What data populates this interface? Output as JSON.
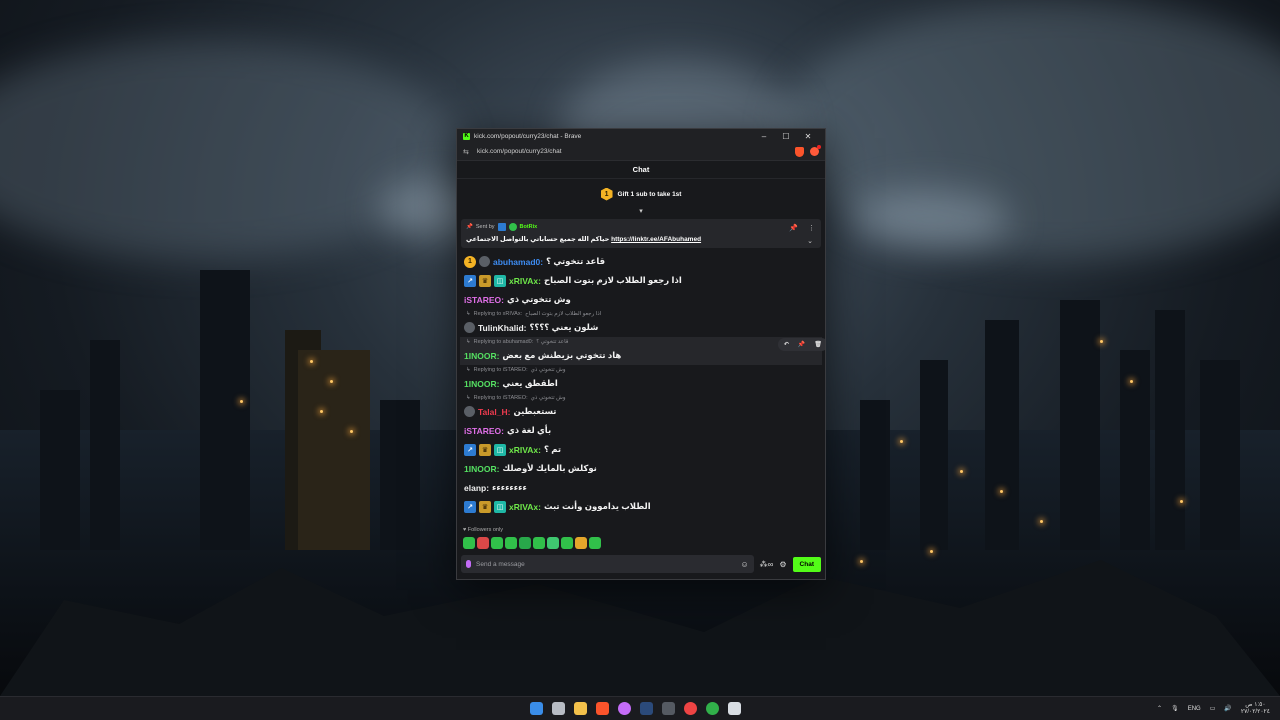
{
  "window": {
    "title": "kick.com/popout/curry23/chat - Brave",
    "url": "kick.com/popout/curry23/chat",
    "controls": {
      "minimize": "–",
      "maximize": "☐",
      "close": "✕"
    }
  },
  "chat": {
    "header": "Chat",
    "gift": {
      "badge": "1",
      "text": "Gift 1 sub to take 1st"
    },
    "pinned": {
      "sent_by": "Sent by",
      "bot_name": "BotRix",
      "message": "حياكم الله جميع حساباتي بالتواصل الاجتماعي",
      "link": "https://linktr.ee/AFAbuhamed"
    },
    "messages": [
      {
        "type": "sub",
        "user": "abuhamad0:",
        "text": "قاعد تتخوتي ؟",
        "color": "u-blue"
      },
      {
        "type": "badges3",
        "user": "xRIVAx:",
        "text": "اذا رجعو الطلاب لازم بتوت الصباح",
        "color": "u-lime"
      },
      {
        "type": "plain",
        "user": "iSTAREO:",
        "text": "وش تتخوتي ذي",
        "color": "u-pink"
      },
      {
        "type": "reply",
        "reply_to": "Replying to xRIVAx:",
        "reply_text": "اذا رجعو الطلاب لازم بتوت الصباح",
        "user": "TulinKhalid:",
        "text": "شلون يعني ؟؟؟؟",
        "color": "u-white"
      },
      {
        "type": "reply-hl",
        "reply_to": "Replying to abuhamad0:",
        "reply_text": "قاعد تتخوتي ؟",
        "user": "1INOOR:",
        "text": "هاد تتخوتي بزيطنش مع بعض",
        "color": "u-green"
      },
      {
        "type": "reply",
        "reply_to": "Replying to iSTAREO:",
        "reply_text": "وش تتخوتي ذي",
        "user": "1INOOR:",
        "text": "اطقطق يعني",
        "color": "u-green"
      },
      {
        "type": "reply",
        "reply_to": "Replying to iSTAREO:",
        "reply_text": "وش تتخوتي ذي",
        "user": "Talal_H:",
        "text": "تستعبطين",
        "color": "u-red"
      },
      {
        "type": "plain",
        "user": "iSTAREO:",
        "text": "بأي لغة ذي",
        "color": "u-pink"
      },
      {
        "type": "badges3",
        "user": "xRIVAx:",
        "text": "تم ؟",
        "color": "u-lime"
      },
      {
        "type": "plain",
        "user": "1INOOR:",
        "text": "نوكلش بالمايك لأوصلك",
        "color": "u-green"
      },
      {
        "type": "plain",
        "user": "elanp:",
        "text": "ءءءءءءءء",
        "color": "u-white"
      },
      {
        "type": "badges3",
        "user": "xRIVAx:",
        "text": "الطلاب يداموون وأنت تبث",
        "color": "u-lime"
      }
    ],
    "followers_only": "Followers only",
    "input_placeholder": "Send a message",
    "send_label": "Chat"
  },
  "taskbar": {
    "lang": "ENG",
    "time": "١:٥٠ ص",
    "date": "٢٧/٠٢/٢٠٢٤"
  }
}
